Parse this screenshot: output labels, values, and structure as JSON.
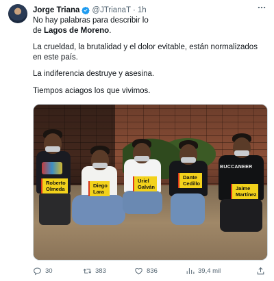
{
  "author": {
    "name": "Jorge Triana",
    "handle": "@JTrianaT",
    "separator": "·",
    "time": "1h",
    "more_icon": "more-icon"
  },
  "tweet": {
    "line1": "No hay palabras para describir lo",
    "line2_prefix": "de ",
    "line2_bold": "Lagos de Moreno",
    "line2_suffix": ".",
    "p2": "La crueldad, la brutalidad y el dolor evitable, están normalizados en este país.",
    "p3": "La indiferencia destruye y asesina.",
    "p4": "Tiempos aciagos los que vivimos."
  },
  "media": {
    "shirt_text": "BUCCANEER",
    "labels": [
      {
        "first": "Roberto",
        "last": "Olmeda"
      },
      {
        "first": "Diego",
        "last": "Lara"
      },
      {
        "first": "Uriel",
        "last": "Galván"
      },
      {
        "first": "Dante",
        "last": "Cedillo"
      },
      {
        "first": "Jaime",
        "last": "Martínez"
      }
    ]
  },
  "actions": {
    "replies": "30",
    "reposts": "383",
    "likes": "836",
    "views": "39,4 mil"
  },
  "colors": {
    "verified": "#1d9bf0",
    "label_bg": "#f3d21b",
    "label_stripe": "#d8361f",
    "muted": "#536471"
  }
}
